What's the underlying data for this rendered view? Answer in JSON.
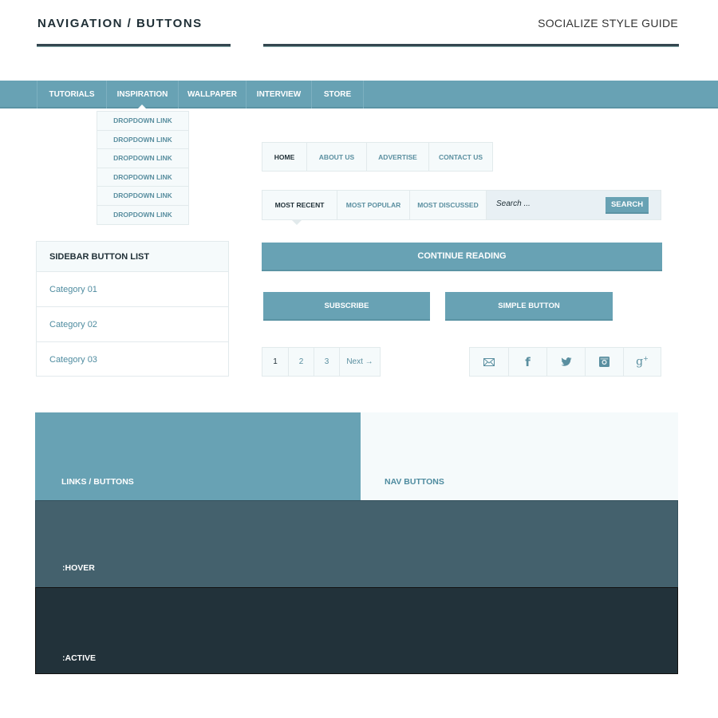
{
  "header": {
    "title": "NAVIGATION / BUTTONS",
    "subtitle": "SOCIALIZE STYLE GUIDE"
  },
  "main_nav": {
    "items": [
      "TUTORIALS",
      "INSPIRATION",
      "WALLPAPER",
      "INTERVIEW",
      "STORE"
    ],
    "active": "INSPIRATION"
  },
  "dropdown": {
    "items": [
      "DROPDOWN LINK",
      "DROPDOWN LINK",
      "DROPDOWN LINK",
      "DROPDOWN LINK",
      "DROPDOWN LINK",
      "DROPDOWN LINK"
    ]
  },
  "tab_nav": {
    "items": [
      "HOME",
      "ABOUT US",
      "ADVERTISE",
      "CONTACT US"
    ],
    "active": "HOME"
  },
  "filter_bar": {
    "items": [
      "MOST RECENT",
      "MOST POPULAR",
      "MOST DISCUSSED"
    ],
    "active": "MOST RECENT",
    "search_placeholder": "Search ...",
    "search_button": "SEARCH"
  },
  "sidebar": {
    "title": "SIDEBAR BUTTON LIST",
    "items": [
      "Category 01",
      "Category 02",
      "Category 03"
    ]
  },
  "buttons": {
    "continue": "CONTINUE READING",
    "subscribe": "SUBSCRIBE",
    "simple": "SIMPLE BUTTON"
  },
  "pagination": {
    "pages": [
      "1",
      "2",
      "3"
    ],
    "next": "Next →",
    "current": "1"
  },
  "social": {
    "icons": [
      "mail-icon",
      "facebook-icon",
      "twitter-icon",
      "instagram-icon",
      "google-plus-icon"
    ]
  },
  "swatches": {
    "links": "LINKS / BUTTONS",
    "nav": "NAV BUTTONS",
    "hover": ":HOVER",
    "active": ":ACTIVE"
  },
  "colors": {
    "primary": "#68a2b4",
    "light": "#f5fafb",
    "hover": "#44616d",
    "active": "#22323a",
    "text": "#1f2f36"
  }
}
